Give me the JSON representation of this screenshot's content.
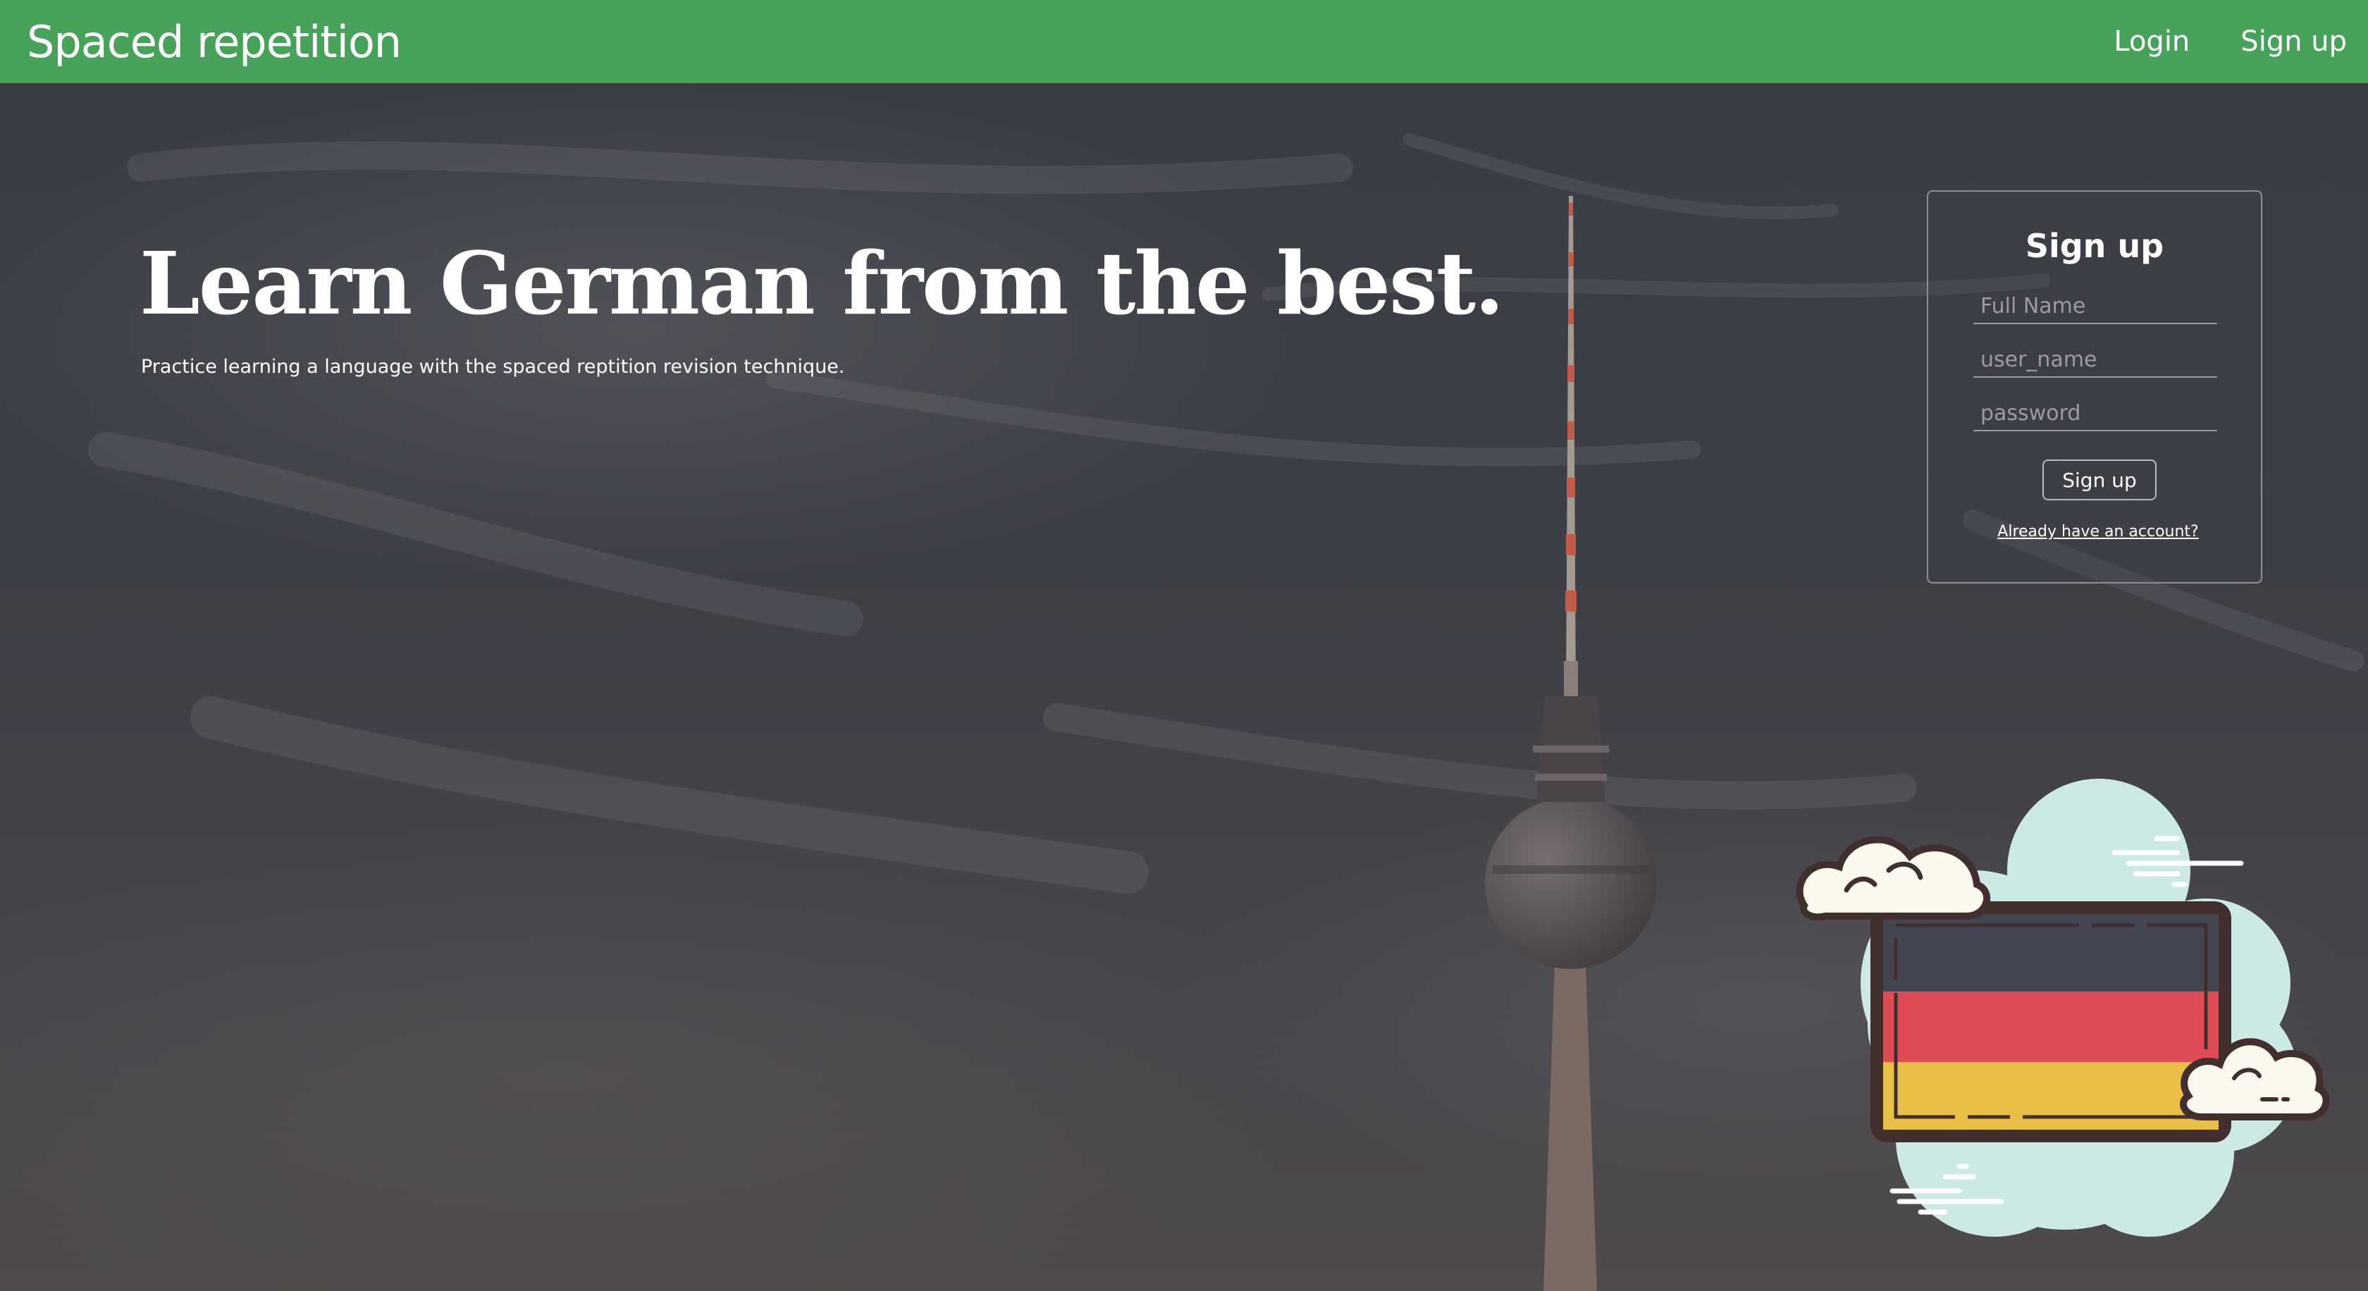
{
  "navbar": {
    "brand": "Spaced repetition",
    "links": {
      "login": "Login",
      "signup": "Sign up"
    },
    "background_color": "#48a35a"
  },
  "hero": {
    "headline": "Learn German from the best.",
    "subtitle": "Practice learning a language with the spaced reptition revision technique."
  },
  "signup_form": {
    "title": "Sign up",
    "full_name_placeholder": "Full Name",
    "username_placeholder": "user_name",
    "password_placeholder": "password",
    "submit_label": "Sign up",
    "login_link": "Already have an account?"
  },
  "illustration": {
    "icon": "german-flag-with-clouds",
    "flag_colors": [
      "#434550",
      "#e04c55",
      "#e9bf48"
    ],
    "cloud_color": "#cce9e6"
  }
}
